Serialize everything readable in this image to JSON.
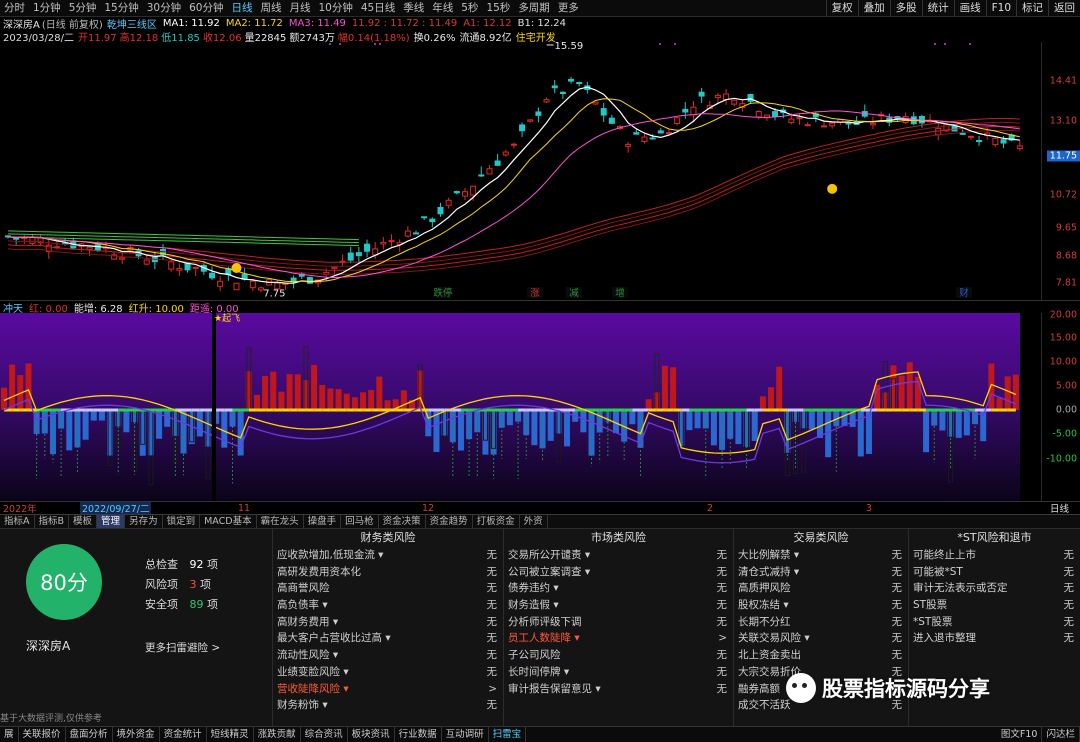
{
  "top_toolbar": {
    "periods": [
      "分时",
      "1分钟",
      "5分钟",
      "15分钟",
      "30分钟",
      "60分钟",
      "日线",
      "周线",
      "月线",
      "10分钟",
      "45日线",
      "季线",
      "年线",
      "5秒",
      "15秒",
      "多周期",
      "更多"
    ],
    "active_period": "日线",
    "tools": [
      "复权",
      "叠加",
      "多股",
      "统计",
      "画线",
      "F10",
      "标记",
      "返回"
    ]
  },
  "chart_header": {
    "stock_name": "深深房A",
    "mode": "(日线 前复权)",
    "indicator": "乾坤三线区",
    "ma1": "MA1: 11.92",
    "ma2": "MA2: 11.72",
    "ma3": "MA3: 11.49",
    "vals": "11.92 : 11.72 : 11.49",
    "a1": "A1: 12.12",
    "b1": "B1: 12.24",
    "date": "2023/03/28/二",
    "open": "开11.97",
    "high": "高12.18",
    "low": "低11.85",
    "close": "收12.06",
    "volume": "量22845",
    "amount": "额2743万",
    "change": "幅0.14(1.18%)",
    "turnover": "换0.26%",
    "float_cap": "流通8.92亿",
    "concept": "住宅开发"
  },
  "price_axis": {
    "ticks": [
      "14.41",
      "13.10",
      "11.75",
      "10.72",
      "9.65",
      "8.68",
      "7.81"
    ],
    "last_price": "11.75"
  },
  "price_labels": {
    "high": "15.59",
    "low": "7.75"
  },
  "event_markers": [
    {
      "text": "跌停",
      "color": "#2c8c3c"
    },
    {
      "text": "涨",
      "color": "#c83232"
    },
    {
      "text": "减",
      "color": "#2c8c3c"
    },
    {
      "text": "增",
      "color": "#2c8c3c"
    },
    {
      "text": "财",
      "color": "#2a55c8"
    }
  ],
  "indicator_header": {
    "name": "冲天",
    "red": "红: 0.00",
    "energy": "能增: 6.28",
    "red_up": "红升: 10.00",
    "distance": "距遥: 0.00",
    "signal": "★起飞"
  },
  "indicator_axis": {
    "ticks": [
      "20.00",
      "15.00",
      "10.00",
      "5.00",
      "0.00",
      "-5.00",
      "-10.00"
    ]
  },
  "time_axis": {
    "labels": [
      "2022年",
      "2022/09/27/二",
      "11",
      "12",
      "2",
      "3"
    ],
    "period": "日线"
  },
  "bottom_tabs": {
    "items": [
      "指标A",
      "指标B",
      "模板",
      "管理",
      "另存为",
      "锁定到",
      "MACD基本",
      "霸在龙头",
      "操盘手",
      "回马枪",
      "资金决策",
      "资金趋势",
      "打板资金",
      "外资"
    ],
    "active": "管理"
  },
  "scan": {
    "score": "80分",
    "stock_name": "深深房A",
    "total_label": "总检查",
    "total_value": "92",
    "total_unit": "项",
    "risk_label": "风险项",
    "risk_value": "3",
    "risk_unit": "项",
    "safe_label": "安全项",
    "safe_value": "89",
    "safe_unit": "项",
    "more_link": "更多扫雷避险 >",
    "footer_note": "基于大数据评测,仅供参考"
  },
  "risk_columns": [
    {
      "title": "财务类风险",
      "rows": [
        {
          "label": "应收款增加,低现金流 ▾",
          "status": "无"
        },
        {
          "label": "高研发费用资本化",
          "status": "无"
        },
        {
          "label": "高商誉风险",
          "status": "无"
        },
        {
          "label": "高负债率 ▾",
          "status": "无"
        },
        {
          "label": "高财务费用 ▾",
          "status": "无"
        },
        {
          "label": "最大客户占营收比过高 ▾",
          "status": "无"
        },
        {
          "label": "流动性风险 ▾",
          "status": "无"
        },
        {
          "label": "业绩变脸风险 ▾",
          "status": "无"
        },
        {
          "label": "营收陡降风险 ▾",
          "status": ">",
          "alert": true
        },
        {
          "label": "财务粉饰 ▾",
          "status": "无"
        }
      ]
    },
    {
      "title": "市场类风险",
      "rows": [
        {
          "label": "交易所公开谴责 ▾",
          "status": "无"
        },
        {
          "label": "公司被立案调查 ▾",
          "status": "无"
        },
        {
          "label": "债券违约 ▾",
          "status": "无"
        },
        {
          "label": "财务造假 ▾",
          "status": "无"
        },
        {
          "label": "分析师评级下调",
          "status": "无"
        },
        {
          "label": "员工人数陡降 ▾",
          "status": ">",
          "alert": true
        },
        {
          "label": "子公司风险",
          "status": "无"
        },
        {
          "label": "长时间停牌 ▾",
          "status": "无"
        },
        {
          "label": "审计报告保留意见 ▾",
          "status": "无"
        }
      ]
    },
    {
      "title": "交易类风险",
      "rows": [
        {
          "label": "大比例解禁 ▾",
          "status": "无"
        },
        {
          "label": "清仓式减持 ▾",
          "status": "无"
        },
        {
          "label": "高质押风险",
          "status": "无"
        },
        {
          "label": "股权冻结 ▾",
          "status": "无"
        },
        {
          "label": "长期不分红",
          "status": "无"
        },
        {
          "label": "关联交易风险 ▾",
          "status": "无"
        },
        {
          "label": "北上资金卖出",
          "status": "无"
        },
        {
          "label": "大宗交易折价",
          "status": "无"
        },
        {
          "label": "融券高额",
          "status": "无"
        },
        {
          "label": "成交不活跃",
          "status": "无"
        }
      ]
    },
    {
      "title": "*ST风险和退市",
      "rows": [
        {
          "label": "可能终止上市",
          "status": "无"
        },
        {
          "label": "可能被*ST",
          "status": "无"
        },
        {
          "label": "审计无法表示或否定",
          "status": "无"
        },
        {
          "label": "ST股票",
          "status": "无"
        },
        {
          "label": "*ST股票",
          "status": "无"
        },
        {
          "label": "进入退市整理",
          "status": "无"
        }
      ]
    }
  ],
  "watermark": "股票指标源码分享",
  "status_bar": {
    "items": [
      "展",
      "关联报价",
      "盘面分析",
      "境外资金",
      "资金统计",
      "短线精灵",
      "涨跌贡献",
      "综合资讯",
      "板块资讯",
      "行业数据",
      "互动调研",
      "扫雷宝"
    ],
    "active": "扫雷宝",
    "right_items": [
      "图文F10",
      "闪达栏"
    ]
  },
  "colors": {
    "up": "#e02828",
    "down": "#20c8c8",
    "ma1": "#ffffff",
    "ma2": "#ffd700",
    "ma3": "#ff4fd8",
    "long_ma": "#b81e1e",
    "green_ma": "#3cc83c",
    "score": "#23b26a",
    "accent": "#4fd0ff"
  }
}
